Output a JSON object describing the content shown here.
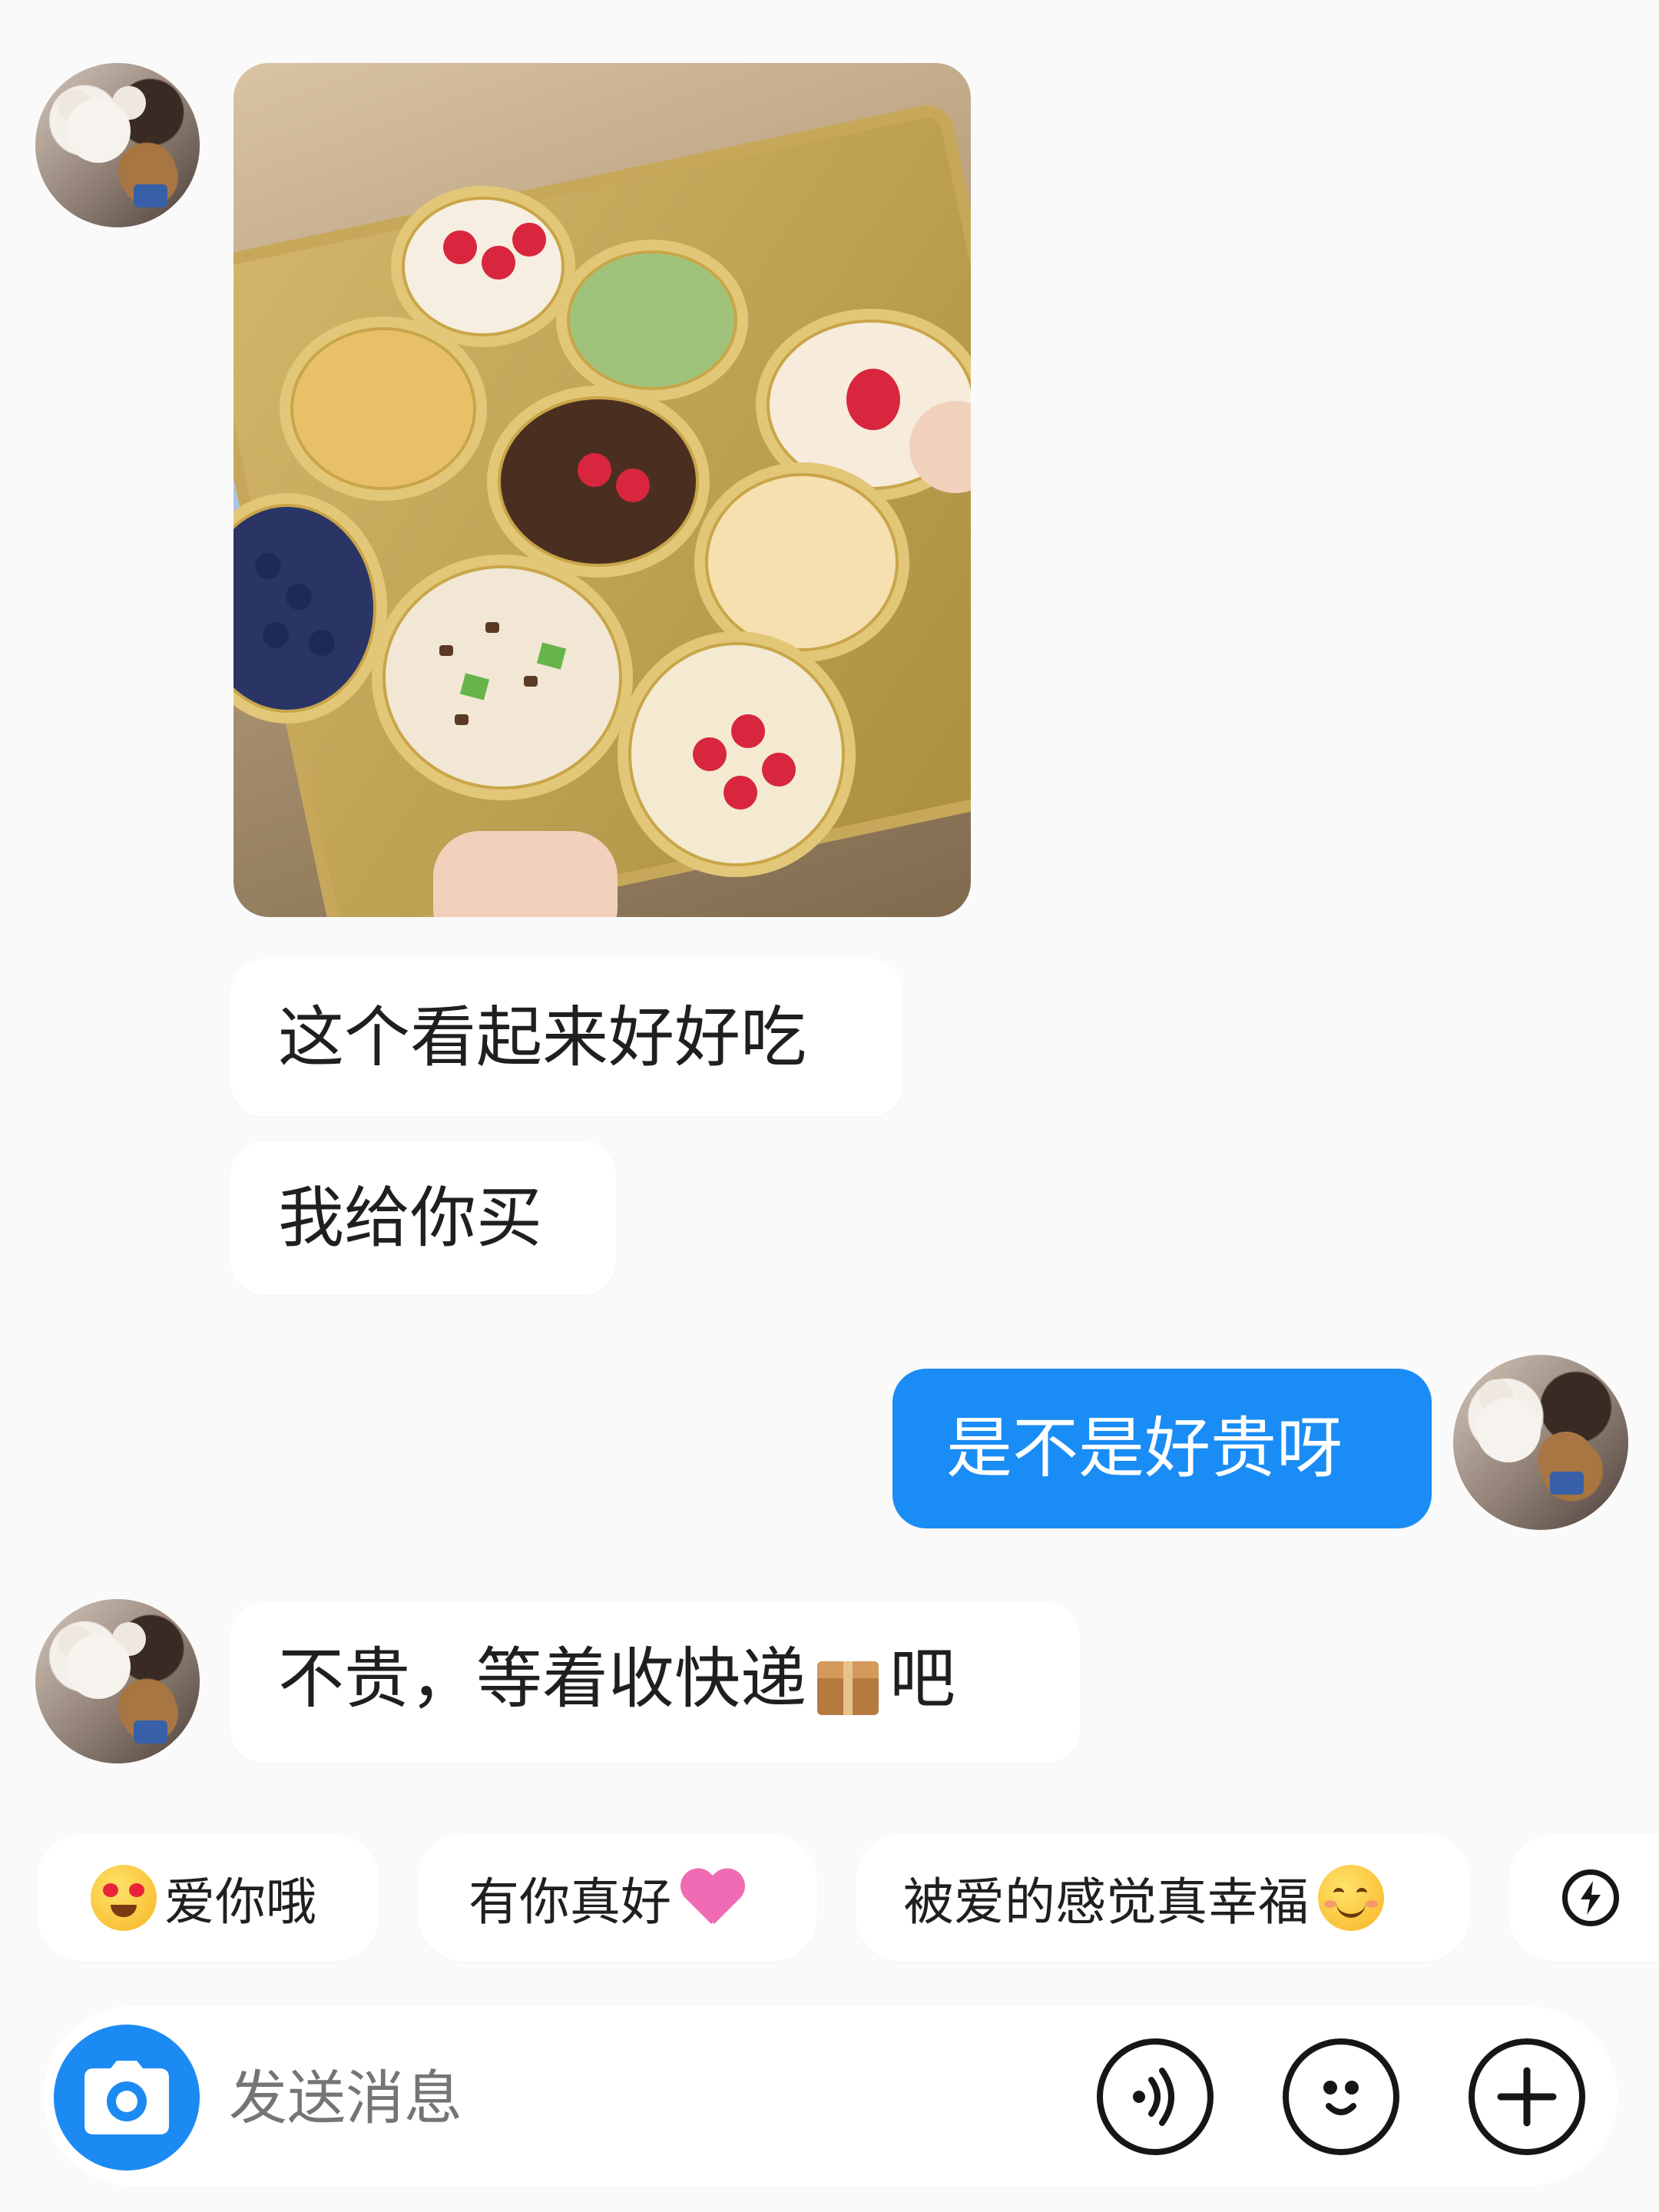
{
  "messages": [
    {
      "type": "image",
      "from": "other"
    },
    {
      "type": "text",
      "from": "other",
      "text": "这个看起来好好吃"
    },
    {
      "type": "text",
      "from": "other",
      "text": "我给你买"
    },
    {
      "type": "text",
      "from": "me",
      "text": "是不是好贵呀"
    },
    {
      "type": "text",
      "from": "other",
      "text_before": "不贵，等着收快递",
      "text_after": "吧"
    }
  ],
  "quick_replies": [
    {
      "text": "爱你哦",
      "emoji": "heart-eyes-emoji"
    },
    {
      "text": "有你真好",
      "emoji": "pink-heart-emoji"
    },
    {
      "text": "被爱的感觉真幸福",
      "emoji": "smile-emoji"
    },
    {
      "text": "",
      "emoji": "lightning-icon"
    }
  ],
  "input": {
    "placeholder": "发送消息"
  },
  "colors": {
    "accent": "#1a8cf5",
    "background": "#fafafa",
    "bubble": "#ffffff"
  }
}
